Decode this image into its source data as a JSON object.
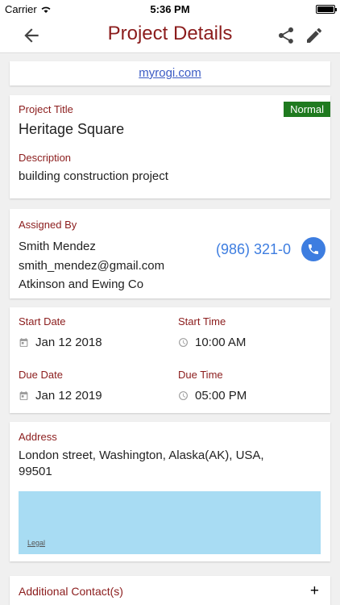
{
  "status_bar": {
    "carrier": "Carrier",
    "time": "5:36 PM"
  },
  "nav": {
    "title": "Project Details",
    "icons": [
      "back-arrow-icon",
      "share-icon",
      "edit-icon"
    ]
  },
  "website": {
    "link": "myrogi.com"
  },
  "project": {
    "title_label": "Project Title",
    "title": "Heritage Square",
    "priority": "Normal",
    "description_label": "Description",
    "description": "building construction project"
  },
  "assigned": {
    "label": "Assigned By",
    "name": "Smith Mendez",
    "email": "smith_mendez@gmail.com",
    "company": "Atkinson and Ewing Co",
    "phone": "(986) 321-0"
  },
  "schedule": {
    "start_date_label": "Start Date",
    "start_date": "Jan 12 2018",
    "start_time_label": "Start Time",
    "start_time": "10:00 AM",
    "due_date_label": "Due Date",
    "due_date": "Jan 12 2019",
    "due_time_label": "Due Time",
    "due_time": "05:00 PM"
  },
  "address": {
    "label": "Address",
    "line1": "London street, Washington, Alaska(AK), USA,",
    "line2": "99501",
    "map_legal": "Legal"
  },
  "contacts": {
    "label": "Additional Contact(s)",
    "add": "+"
  },
  "colors": {
    "accent": "#8b1c1c",
    "link": "#3b5bc4",
    "phone": "#3d7de0",
    "badge": "#1f7a1f",
    "map": "#a8dcf3"
  }
}
